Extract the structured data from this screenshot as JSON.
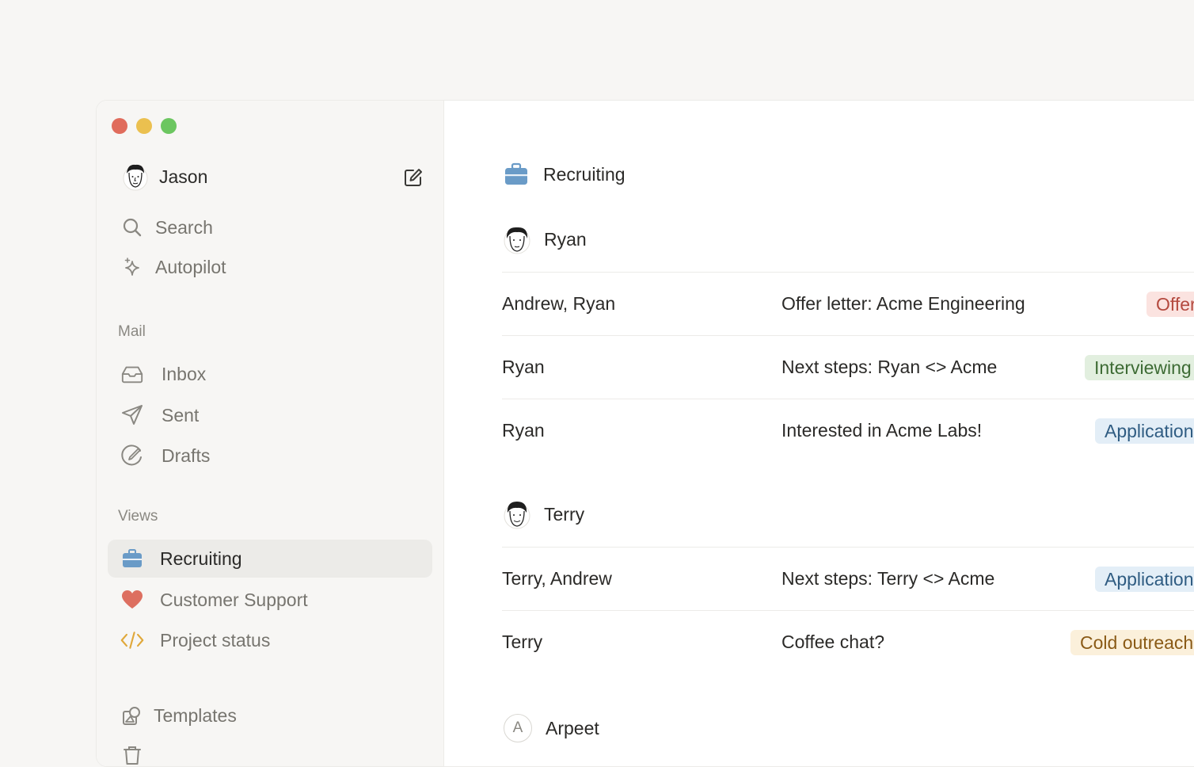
{
  "sidebar": {
    "user_name": "Jason",
    "search_label": "Search",
    "autopilot_label": "Autopilot",
    "mail_section": "Mail",
    "inbox_label": "Inbox",
    "sent_label": "Sent",
    "drafts_label": "Drafts",
    "views_section": "Views",
    "views": [
      {
        "label": "Recruiting",
        "icon": "briefcase-icon",
        "color": "#6a9bc7",
        "selected": true
      },
      {
        "label": "Customer Support",
        "icon": "heart-icon",
        "color": "#dd6f60",
        "selected": false
      },
      {
        "label": "Project status",
        "icon": "code-icon",
        "color": "#e0a83a",
        "selected": false
      }
    ],
    "templates_label": "Templates"
  },
  "main": {
    "view_title": "Recruiting",
    "groups": [
      {
        "name": "Ryan",
        "rows": [
          {
            "from": "Andrew, Ryan",
            "subject": "Offer letter: Acme Engineering",
            "tag": "Offer"
          },
          {
            "from": "Ryan",
            "subject": "Next steps: Ryan <> Acme",
            "tag": "Interviewing"
          },
          {
            "from": "Ryan",
            "subject": "Interested in Acme Labs!",
            "tag": "Application"
          }
        ]
      },
      {
        "name": "Terry",
        "rows": [
          {
            "from": "Terry, Andrew",
            "subject": "Next steps: Terry <> Acme",
            "tag": "Application"
          },
          {
            "from": "Terry",
            "subject": "Coffee chat?",
            "tag": "Cold outreach"
          }
        ]
      },
      {
        "name": "Arpeet",
        "avatar_letter": "A",
        "rows": []
      }
    ]
  },
  "colors": {
    "offer_tag_bg": "#fbe3e0",
    "interviewing_tag_bg": "#e2efdf",
    "application_tag_bg": "#e3eef7",
    "cold_outreach_tag_bg": "#fbf0db"
  }
}
